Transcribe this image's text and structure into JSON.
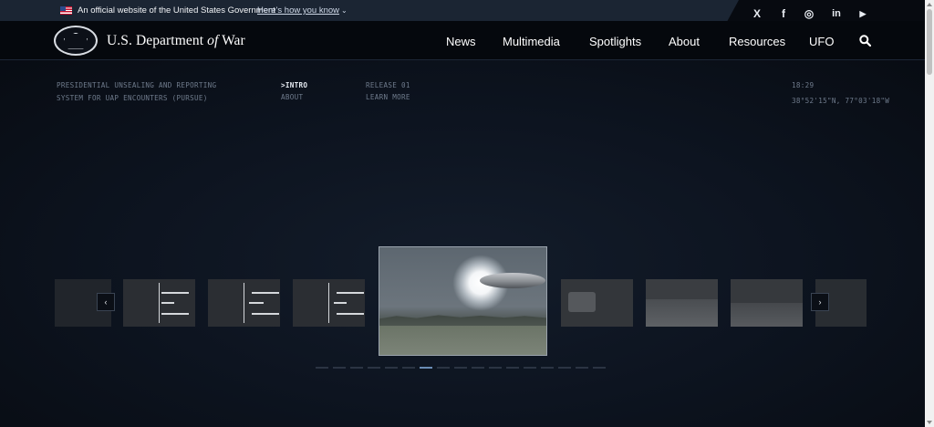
{
  "gov_banner": {
    "text": "An official website of the United States Government",
    "link": "Here's how you know",
    "chevron": "⌄"
  },
  "social": [
    {
      "icon": "x-icon",
      "glyph": "X"
    },
    {
      "icon": "facebook-icon",
      "glyph": "f"
    },
    {
      "icon": "instagram-icon",
      "glyph": "◎"
    },
    {
      "icon": "linkedin-icon",
      "glyph": "in"
    },
    {
      "icon": "youtube-icon",
      "glyph": "▶"
    }
  ],
  "header": {
    "brand_pre": "U.S. Department",
    "brand_of": "of",
    "brand_post": "War",
    "nav": [
      "News",
      "Multimedia",
      "Spotlights",
      "About",
      "Resources",
      "UFO"
    ]
  },
  "hero": {
    "title_line1": "PRESIDENTIAL UNSEALING AND REPORTING",
    "title_line2": "SYSTEM FOR UAP ENCOUNTERS (PURSUE)",
    "intro": ">INTRO",
    "about": "ABOUT",
    "release": "RELEASE 01",
    "learn_more": "LEARN MORE",
    "time": "18:29",
    "coords": "38°52'15\"N, 77°03'18\"W"
  },
  "carousel": {
    "prev": "‹",
    "next": "›",
    "slide_count": 17,
    "active_index": 6
  }
}
